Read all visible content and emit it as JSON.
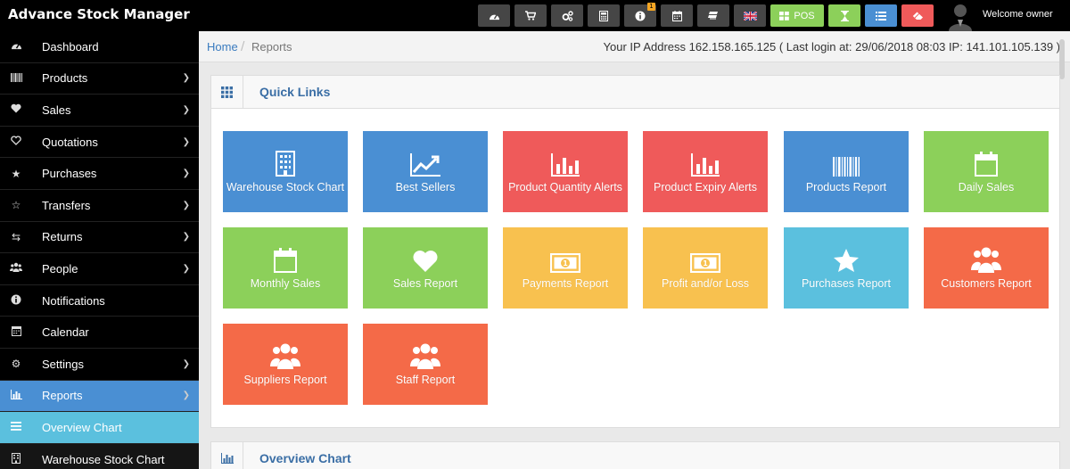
{
  "app": {
    "title": "Advance Stock Manager"
  },
  "topbar": {
    "buttons": [
      {
        "icon": "dashboard-icon"
      },
      {
        "icon": "cart-icon"
      },
      {
        "icon": "cogs-icon"
      },
      {
        "icon": "calculator-icon"
      },
      {
        "icon": "info-icon",
        "badge": "1"
      },
      {
        "icon": "calendar-icon"
      },
      {
        "icon": "stack-icon"
      },
      {
        "icon": "uk-flag-icon"
      },
      {
        "icon": "grid-icon",
        "label": "POS"
      },
      {
        "icon": "hourglass-icon"
      },
      {
        "icon": "list-icon"
      },
      {
        "icon": "eraser-icon"
      }
    ],
    "welcome": "Welcome owner",
    "colors": {
      "green": "#8cd05a",
      "blue": "#4a8fd3",
      "red": "#ef5a5a",
      "dark": "#464646"
    }
  },
  "sidebar": {
    "items": [
      {
        "label": "Dashboard",
        "icon": "dashboard-icon"
      },
      {
        "label": "Products",
        "icon": "barcode-icon"
      },
      {
        "label": "Sales",
        "icon": "heart-icon"
      },
      {
        "label": "Quotations",
        "icon": "heart-outline-icon"
      },
      {
        "label": "Purchases",
        "icon": "star-icon"
      },
      {
        "label": "Transfers",
        "icon": "star-outline-icon"
      },
      {
        "label": "Returns",
        "icon": "shuffle-icon"
      },
      {
        "label": "People",
        "icon": "users-icon"
      },
      {
        "label": "Notifications",
        "icon": "info-icon"
      },
      {
        "label": "Calendar",
        "icon": "calendar-icon"
      },
      {
        "label": "Settings",
        "icon": "gear-icon"
      },
      {
        "label": "Reports",
        "icon": "bar-chart-icon"
      },
      {
        "label": "Overview Chart",
        "icon": "list-icon"
      },
      {
        "label": "Warehouse Stock Chart",
        "icon": "building-icon"
      }
    ]
  },
  "breadcrumb": {
    "home": "Home",
    "separator": "/",
    "current": "Reports",
    "ip_info": "Your IP Address 162.158.165.125 ( Last login at: 29/06/2018 08:03 IP: 141.101.105.139 )"
  },
  "quick_links": {
    "title": "Quick Links",
    "tiles": [
      {
        "label": "Warehouse Stock Chart",
        "icon": "building-icon",
        "color": "#4a8fd3"
      },
      {
        "label": "Best Sellers",
        "icon": "line-chart-icon",
        "color": "#4a8fd3"
      },
      {
        "label": "Product Quantity Alerts",
        "icon": "bar-chart-icon",
        "color": "#ef5a5a"
      },
      {
        "label": "Product Expiry Alerts",
        "icon": "bar-chart-icon",
        "color": "#ef5a5a"
      },
      {
        "label": "Products Report",
        "icon": "barcode-icon",
        "color": "#4a8fd3"
      },
      {
        "label": "Daily Sales",
        "icon": "calendar-icon",
        "color": "#8cd05a"
      },
      {
        "label": "Monthly Sales",
        "icon": "calendar-icon",
        "color": "#8cd05a"
      },
      {
        "label": "Sales Report",
        "icon": "heart-icon",
        "color": "#8cd05a"
      },
      {
        "label": "Payments Report",
        "icon": "money-icon",
        "color": "#f8c14f"
      },
      {
        "label": "Profit and/or Loss",
        "icon": "money-icon",
        "color": "#f8c14f"
      },
      {
        "label": "Purchases Report",
        "icon": "star-icon",
        "color": "#5bc0de"
      },
      {
        "label": "Customers Report",
        "icon": "users-icon",
        "color": "#f46a48"
      },
      {
        "label": "Suppliers Report",
        "icon": "users-icon",
        "color": "#f46a48"
      },
      {
        "label": "Staff Report",
        "icon": "users-icon",
        "color": "#f46a48"
      }
    ]
  },
  "overview": {
    "title": "Overview Chart"
  }
}
